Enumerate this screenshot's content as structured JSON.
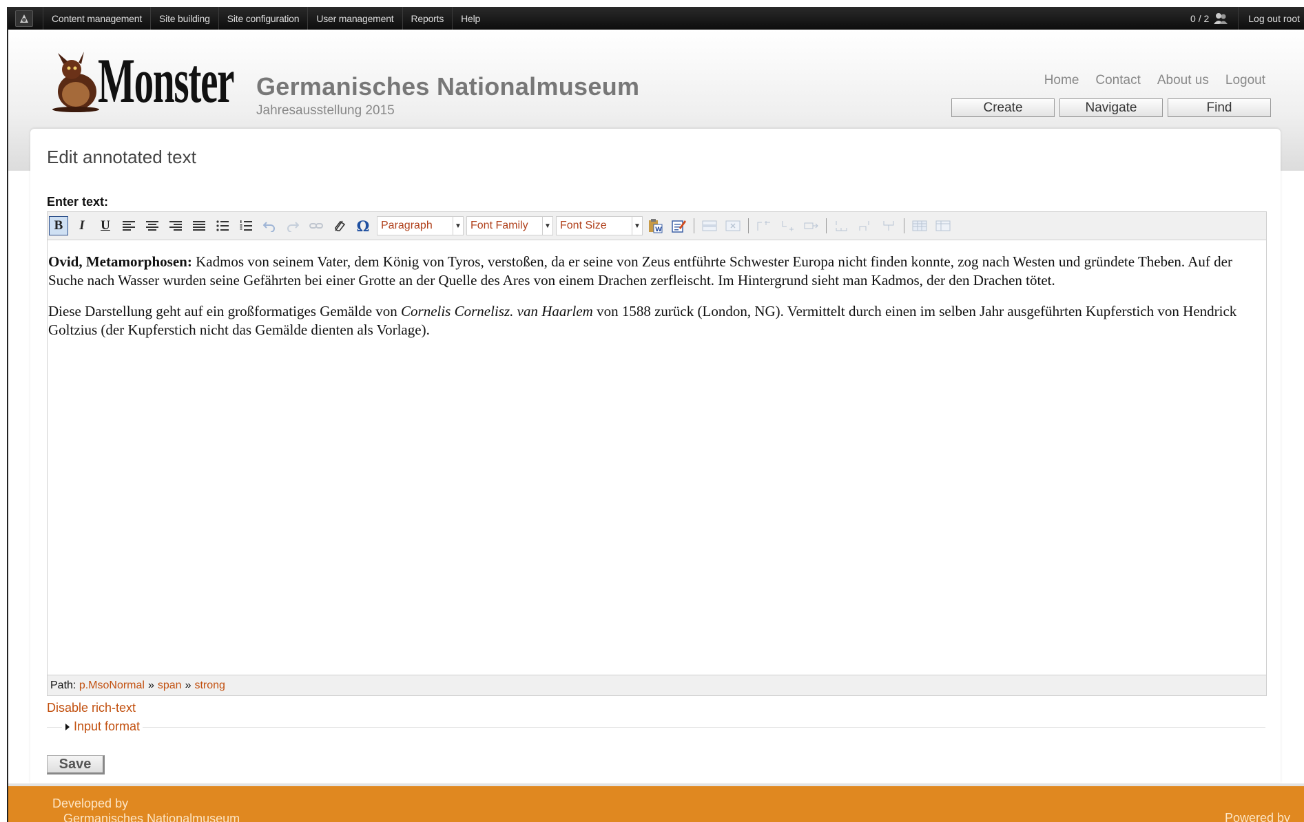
{
  "admin_bar": {
    "menu": [
      "Content management",
      "Site building",
      "Site configuration",
      "User management",
      "Reports",
      "Help"
    ],
    "users_count": "0 / 2",
    "logout": "Log out root"
  },
  "header": {
    "logo_word": "Monster",
    "site_name": "Germanisches Nationalmuseum",
    "slogan": "Jahresausstellung 2015",
    "nav": [
      "Home",
      "Contact",
      "About us",
      "Logout"
    ],
    "buttons": [
      "Create",
      "Navigate",
      "Find"
    ]
  },
  "main": {
    "title": "Edit annotated text",
    "field_label": "Enter text:",
    "toolbar": {
      "dropdowns": [
        "Paragraph",
        "Font Family",
        "Font Size"
      ]
    },
    "content": {
      "p1_bold": "Ovid, Metamorphosen:",
      "p1_text": " Kadmos von seinem Vater, dem König von Tyros, verstoßen, da er seine von Zeus entführte Schwester Europa nicht finden konnte, zog nach Westen und gründete Theben. Auf der Suche nach Wasser wurden seine Gefährten bei einer Grotte an der Quelle des Ares von einem Drachen zerfleischt. Im Hintergrund sieht man Kadmos, der den Drachen tötet.",
      "p2_a": "Diese Darstellung geht auf ein großformatiges Gemälde von ",
      "p2_italic": "Cornelis Cornelisz. van Haarlem",
      "p2_b": " von 1588 zurück (London, NG). Vermittelt durch einen im selben Jahr ausgeführten Kupferstich von Hendrick Goltzius (der Kupferstich nicht das Gemälde dienten als Vorlage)."
    },
    "path": {
      "label": "Path:",
      "items": [
        "p.MsoNormal",
        "span",
        "strong"
      ],
      "separator": "»"
    },
    "disable_link": "Disable rich-text",
    "input_format": "Input format",
    "save": "Save"
  },
  "footer": {
    "developed_by": "Developed by",
    "developer": "Germanisches Nationalmuseum",
    "powered_by": "Powered by"
  }
}
